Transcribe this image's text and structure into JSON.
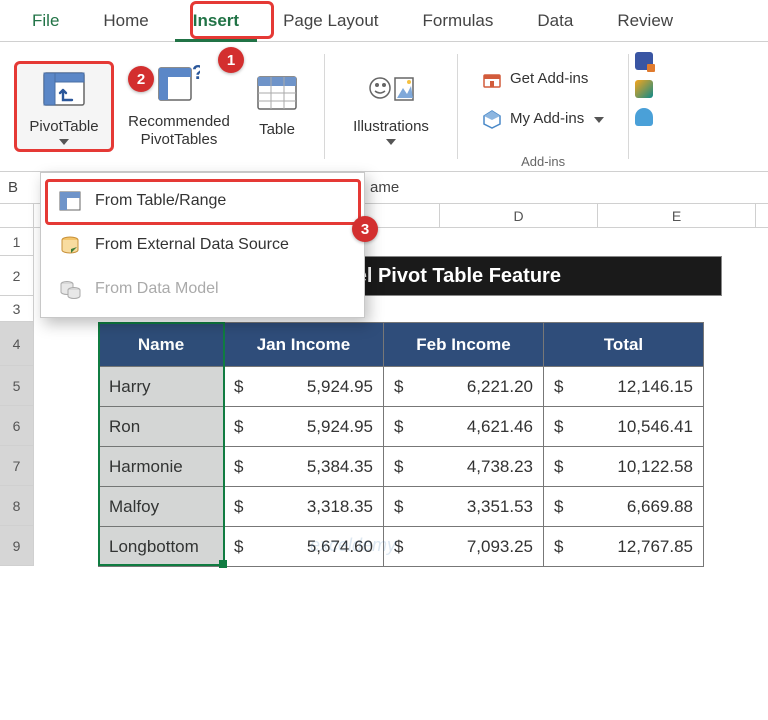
{
  "tabs": {
    "file": "File",
    "home": "Home",
    "insert": "Insert",
    "pageLayout": "Page Layout",
    "formulas": "Formulas",
    "data": "Data",
    "review": "Review"
  },
  "ribbon": {
    "pivotTable": "PivotTable",
    "recommended_l1": "Recommended",
    "recommended_l2": "PivotTables",
    "table": "Table",
    "illustrations": "Illustrations",
    "getAddins": "Get Add-ins",
    "myAddins": "My Add-ins",
    "addinsGroup": "Add-ins"
  },
  "dropdown": {
    "fromTable": "From Table/Range",
    "fromExternal": "From External Data Source",
    "fromModel": "From Data Model"
  },
  "callouts": {
    "c1": "1",
    "c2": "2",
    "c3": "3"
  },
  "fbar": {
    "left": "B",
    "mid": "ame"
  },
  "cols": {
    "D": "D",
    "E": "E"
  },
  "rows": {
    "r1": "1",
    "r2": "2",
    "r3": "3",
    "r4": "4",
    "r5": "5",
    "r6": "6",
    "r7": "7",
    "r8": "8",
    "r9": "9"
  },
  "title": "Using Excel Pivot Table Feature",
  "headers": {
    "name": "Name",
    "jan": "Jan Income",
    "feb": "Feb Income",
    "total": "Total"
  },
  "curr": "$",
  "data": [
    {
      "name": "Harry",
      "jan": "5,924.95",
      "feb": "6,221.20",
      "total": "12,146.15"
    },
    {
      "name": "Ron",
      "jan": "5,924.95",
      "feb": "4,621.46",
      "total": "10,546.41"
    },
    {
      "name": "Harmonie",
      "jan": "5,384.35",
      "feb": "4,738.23",
      "total": "10,122.58"
    },
    {
      "name": "Malfoy",
      "jan": "3,318.35",
      "feb": "3,351.53",
      "total": "6,669.88"
    },
    {
      "name": "Longbottom",
      "jan": "5,674.60",
      "feb": "7,093.25",
      "total": "12,767.85"
    }
  ],
  "watermark": "exceldemy"
}
